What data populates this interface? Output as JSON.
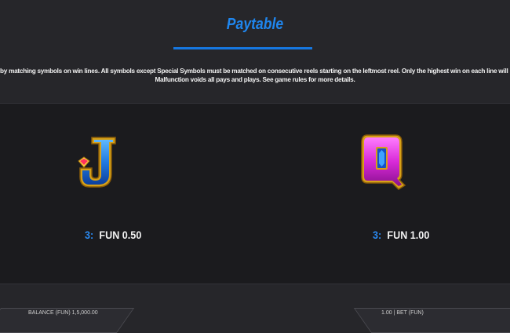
{
  "header": {
    "title": "Paytable",
    "accent_color": "#1f86ee"
  },
  "rules": {
    "line1": "by matching symbols on win lines. All symbols except Special Symbols must be matched on consecutive reels starting on the leftmost reel. Only the highest win on each line will be paid.",
    "line2": "Malfunction voids all pays and plays. See game rules for more details."
  },
  "symbols": [
    {
      "icon": "letter-j-symbol-icon",
      "count": "3:",
      "payout": "FUN 0.50"
    },
    {
      "icon": "letter-q-symbol-icon",
      "count": "3:",
      "payout": "FUN 1.00"
    }
  ],
  "footer": {
    "balance_label": "BALANCE (FUN) 1,5,000.00",
    "bet_label": "1.00 | BET (FUN)"
  }
}
